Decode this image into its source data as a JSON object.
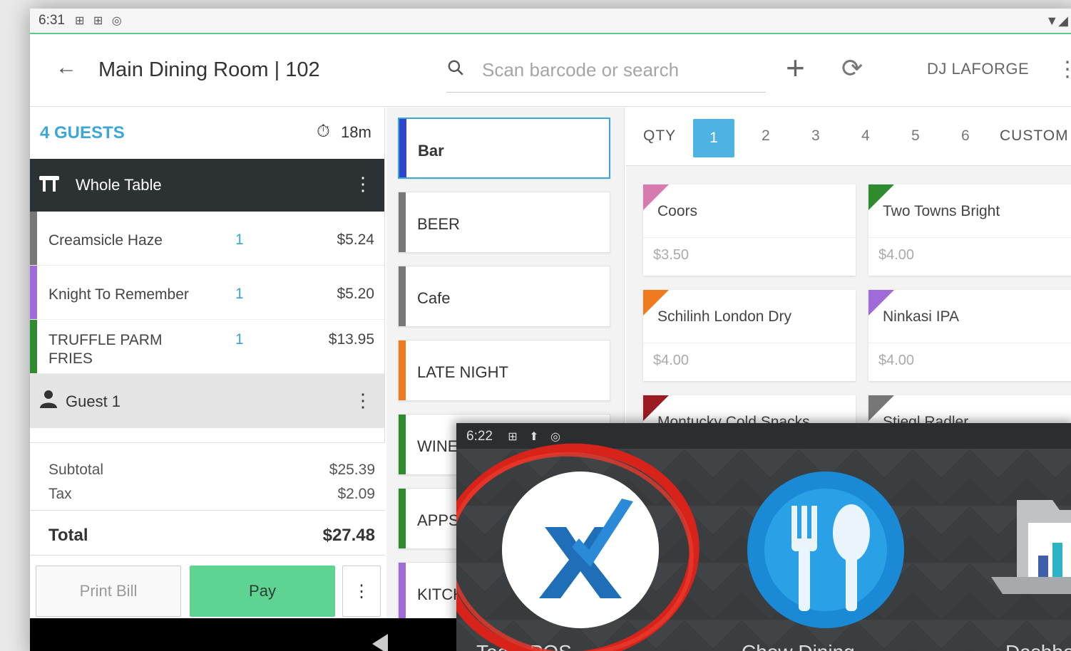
{
  "status_bar": {
    "time": "6:31",
    "icons": "⊞ ⊞ ◎",
    "right_icons": "▼◢"
  },
  "app_bar": {
    "title": "Main Dining Room | 102",
    "search_placeholder": "Scan barcode or search",
    "user": "DJ LAFORGE"
  },
  "order": {
    "guests_label": "4 GUESTS",
    "timer": "18m",
    "table_label": "Whole Table",
    "items": [
      {
        "name": "Creamsicle Haze",
        "qty": "1",
        "price": "$5.24",
        "color": "#777777"
      },
      {
        "name": "Knight To Remember",
        "qty": "1",
        "price": "$5.20",
        "color": "#a06ad8"
      },
      {
        "name": "TRUFFLE PARM FRIES",
        "qty": "1",
        "price": "$13.95",
        "color": "#2e8b2e"
      }
    ],
    "guest_label": "Guest 1",
    "subtotal_label": "Subtotal",
    "subtotal": "$25.39",
    "tax_label": "Tax",
    "tax": "$2.09",
    "total_label": "Total",
    "total": "$27.48",
    "print_bill": "Print Bill",
    "pay": "Pay",
    "more": "⋮"
  },
  "categories": [
    {
      "label": "Bar",
      "color": "#2f45c9",
      "active": true
    },
    {
      "label": "BEER",
      "color": "#777777"
    },
    {
      "label": "Cafe",
      "color": "#777777"
    },
    {
      "label": "LATE NIGHT",
      "color": "#f07a20"
    },
    {
      "label": "WINE",
      "color": "#2e8b2e"
    },
    {
      "label": "APPS",
      "color": "#2e8b2e"
    },
    {
      "label": "KITCHEN",
      "color": "#a06ad8"
    }
  ],
  "qty_bar": {
    "label": "QTY",
    "options": [
      "1",
      "2",
      "3",
      "4",
      "5",
      "6"
    ],
    "selected": "1",
    "custom": "CUSTOM"
  },
  "products": [
    {
      "name": "Coors",
      "price": "$3.50",
      "color": "#d67ab0"
    },
    {
      "name": "Two Towns Bright",
      "price": "$4.00",
      "color": "#2e8b2e"
    },
    {
      "name": "Schilinh London Dry",
      "price": "$4.00",
      "color": "#f07a20"
    },
    {
      "name": "Ninkasi IPA",
      "price": "$4.00",
      "color": "#a06ad8"
    },
    {
      "name": "Montucky Cold Snacks",
      "price": "",
      "color": "#9b1c22"
    },
    {
      "name": "Stiegl Radler",
      "price": "",
      "color": "#777777"
    }
  ],
  "overlay": {
    "time": "6:22",
    "icons": "⊞ ⬆ ◎",
    "apps": [
      {
        "label": "Toast POS",
        "icon": "x-check-icon"
      },
      {
        "label": "Chow Dining",
        "icon": "fork-spoon-icon"
      },
      {
        "label": "Dashboard",
        "icon": "folder-chart-icon"
      }
    ]
  }
}
